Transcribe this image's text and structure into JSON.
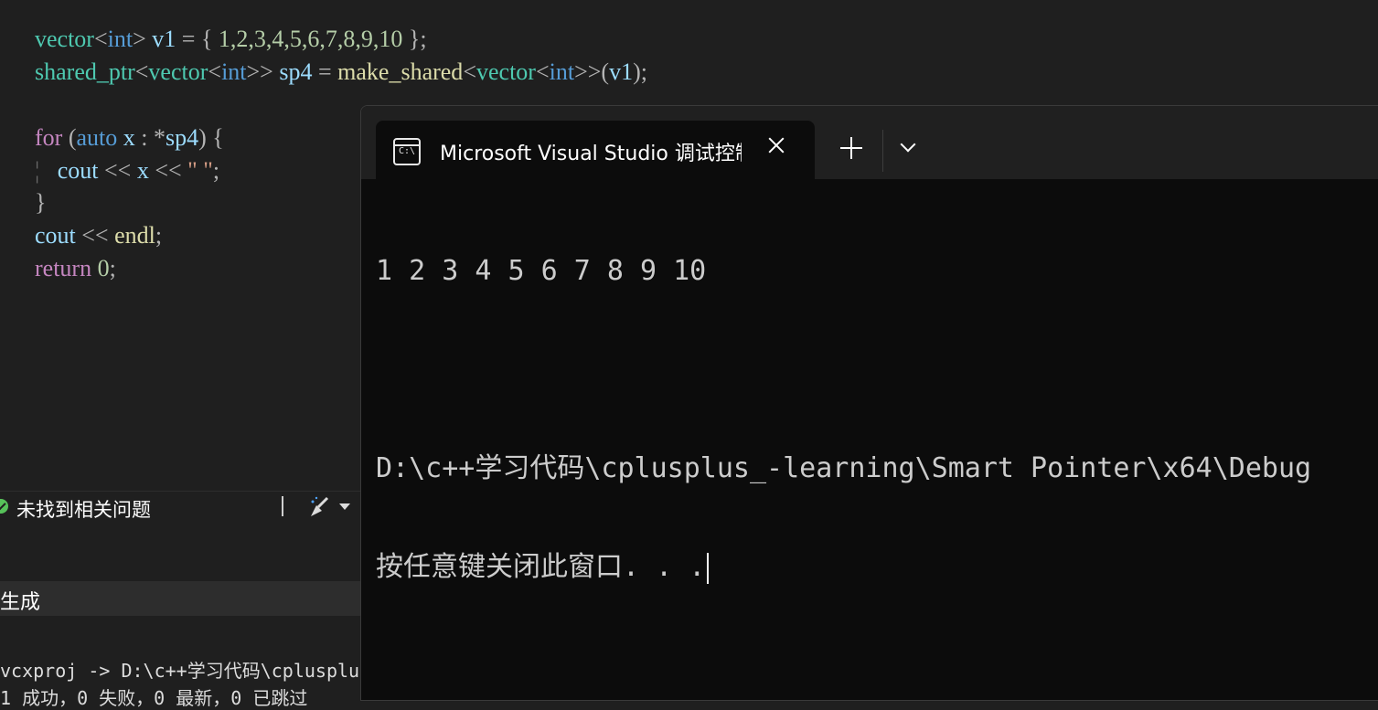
{
  "editor": {
    "line1": {
      "type": "vector",
      "lt": "<",
      "inner": "int",
      "gt": ">",
      "var": "v1",
      "eq": "=",
      "open": "{",
      "values": "1,2,3,4,5,6,7,8,9,10",
      "close": "};"
    },
    "line2": {
      "type": "shared_ptr",
      "lt": "<",
      "inner_type": "vector",
      "lt2": "<",
      "inner": "int",
      "gt": ">>",
      "var": "sp4",
      "eq": "=",
      "fn": "make_shared",
      "lt3": "<",
      "fn_type": "vector",
      "lt4": "<",
      "fn_inner": "int",
      "gt2": ">>",
      "args_open": "(",
      "arg": "v1",
      "args_close": ");"
    },
    "line3": {
      "kw": "for",
      "open": "(",
      "auto": "auto",
      "x": "x",
      "colon": ":",
      "deref": "*",
      "sp": "sp4",
      "close": ")",
      "brace": "{"
    },
    "line4": {
      "guide": "¦",
      "cout": "cout",
      "op1": "<<",
      "x": "x",
      "op2": "<<",
      "str": "\" \"",
      "semi": ";"
    },
    "line5": {
      "brace": "}"
    },
    "line6": {
      "cout": "cout",
      "op": "<<",
      "endl": "endl",
      "semi": ";"
    },
    "line7": {
      "kw": "return",
      "val": "0",
      "semi": ";"
    }
  },
  "statusbar": {
    "message": "未找到相关问题",
    "icons": [
      "check-circle-icon",
      "brush-icon",
      "chevron-down-icon"
    ]
  },
  "output": {
    "title": "生成",
    "line1": "vcxproj -> D:\\c++学习代码\\cplusplus",
    "line2": "1 成功，0 失败，0 最新，0 已跳过"
  },
  "terminal": {
    "tab_title": "Microsoft Visual Studio 调试控制台",
    "icon_text": "C:\\",
    "lines": [
      "1 2 3 4 5 6 7 8 9 10",
      "",
      "D:\\c++学习代码\\cplusplus_-learning\\Smart Pointer\\x64\\Debug",
      "按任意键关闭此窗口. . ."
    ]
  },
  "colors": {
    "editor_bg": "#1f1f1f",
    "terminal_bg": "#0c0c0c",
    "tabbar_bg": "#202020",
    "keyword": "#569cd6",
    "control_keyword": "#c586c0",
    "type": "#4ec9b0",
    "variable": "#9cdcfe",
    "function": "#dcdcaa",
    "number": "#b5cea8",
    "string": "#d69d85",
    "success": "#57c25a"
  }
}
